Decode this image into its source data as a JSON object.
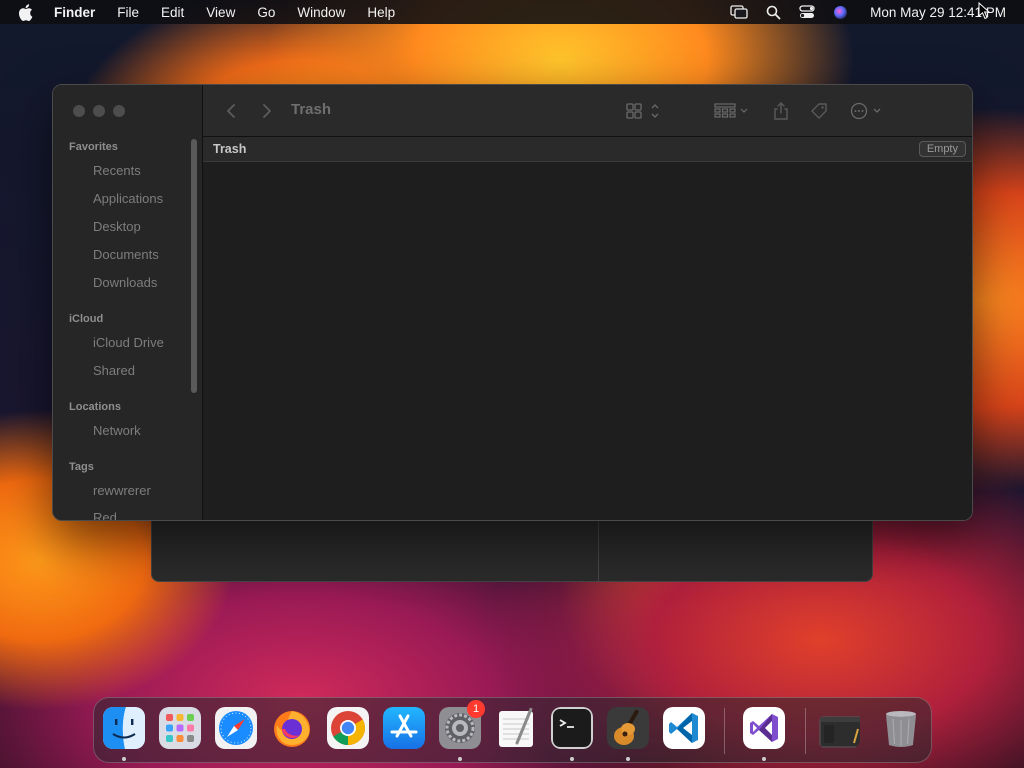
{
  "menubar": {
    "app_name": "Finder",
    "menus": [
      "File",
      "Edit",
      "View",
      "Go",
      "Window",
      "Help"
    ],
    "status_icons": [
      "screen-mirroring-icon",
      "spotlight-search-icon",
      "control-center-icon",
      "siri-icon"
    ],
    "clock": "Mon May 29  12:41 PM"
  },
  "finder": {
    "title": "Trash",
    "path_label": "Trash",
    "empty_button": "Empty",
    "sidebar": {
      "favorites_header": "Favorites",
      "favorites": [
        "Recents",
        "Applications",
        "Desktop",
        "Documents",
        "Downloads"
      ],
      "icloud_header": "iCloud",
      "icloud": [
        "iCloud Drive",
        "Shared"
      ],
      "locations_header": "Locations",
      "locations": [
        "Network"
      ],
      "tags_header": "Tags",
      "tags": [
        "rewwrerer",
        "Red"
      ]
    }
  },
  "dock": {
    "apps": [
      "Finder",
      "Launchpad",
      "Safari",
      "Firefox",
      "Chrome",
      "App Store",
      "System Settings",
      "TextEdit",
      "Terminal",
      "GarageBand",
      "Visual Studio Code",
      "Visual Studio",
      "Screenshot",
      "Trash"
    ],
    "settings_badge": "1"
  },
  "colors": {
    "window_bg": "#1e1e1e",
    "sidebar_bg": "#262626",
    "badge_red": "#ff3b30"
  }
}
